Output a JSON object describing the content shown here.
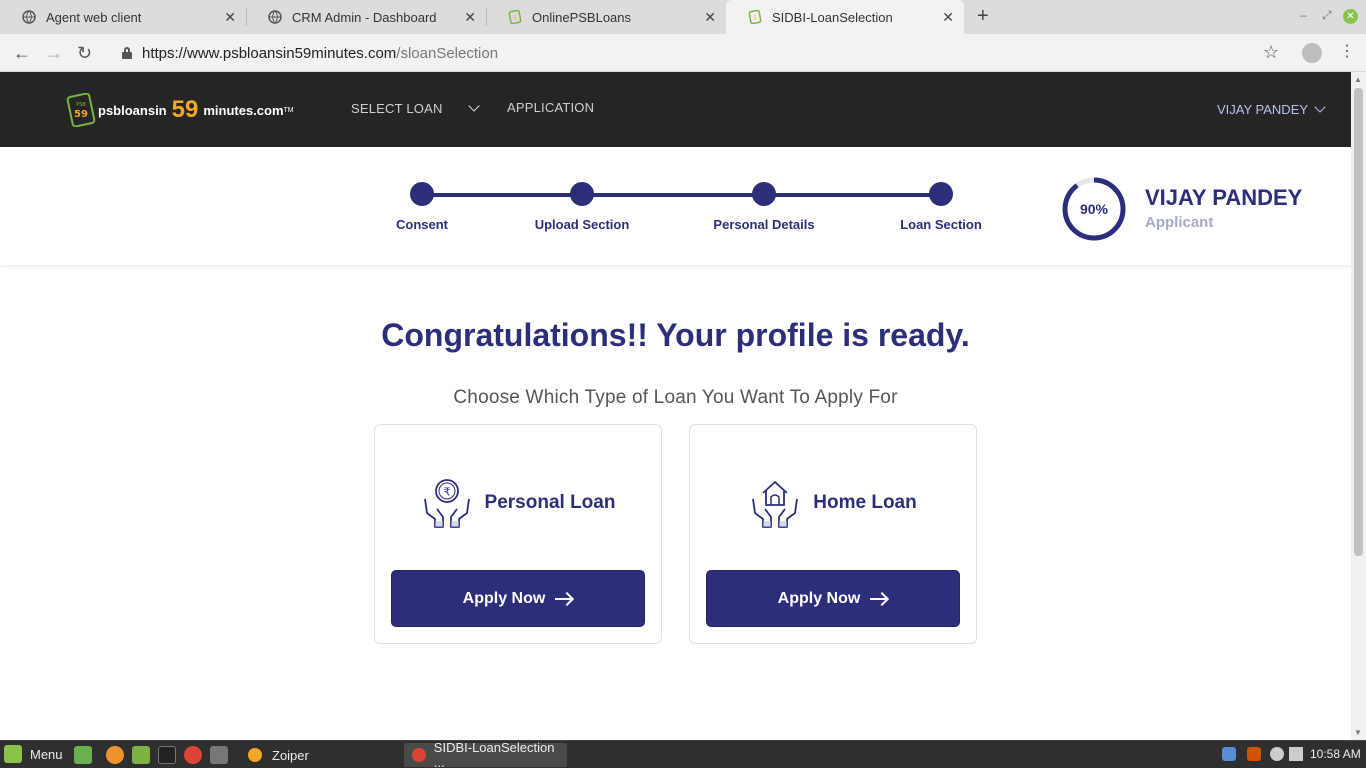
{
  "browser": {
    "tabs": [
      {
        "title": "Agent web client",
        "active": false
      },
      {
        "title": "CRM Admin - Dashboard",
        "active": false
      },
      {
        "title": "OnlinePSBLoans",
        "active": false
      },
      {
        "title": "SIDBI-LoanSelection",
        "active": true
      }
    ],
    "url_host": "https://www.psbloansin59minutes.com",
    "url_path": "/sloanSelection"
  },
  "site": {
    "logo": {
      "badge_top": "PSB",
      "badge_num": "59",
      "text1": "psbloansin",
      "number": "59",
      "text2": "minutes.com",
      "tm": "TM"
    },
    "nav": {
      "select_loan": "SELECT LOAN",
      "application": "APPLICATION",
      "user": "VIJAY PANDEY"
    }
  },
  "progress": {
    "steps": [
      "Consent",
      "Upload Section",
      "Personal Details",
      "Loan Section"
    ],
    "percent_label": "90%",
    "percent_value": 90,
    "user_name": "VIJAY PANDEY",
    "user_role": "Applicant"
  },
  "main": {
    "headline": "Congratulations!! Your profile is ready.",
    "subheading": "Choose Which Type of Loan You Want To Apply For",
    "cards": [
      {
        "title": "Personal Loan",
        "icon": "rupee-coin-hands-icon",
        "button": "Apply Now"
      },
      {
        "title": "Home Loan",
        "icon": "house-hands-icon",
        "button": "Apply Now"
      }
    ]
  },
  "taskbar": {
    "menu": "Menu",
    "tasks": [
      "Zoiper",
      "SIDBI-LoanSelection ..."
    ],
    "clock": "10:58 AM"
  },
  "colors": {
    "brand": "#2c2e7a",
    "nav_bg": "#252525",
    "accent": "#f5a623"
  }
}
